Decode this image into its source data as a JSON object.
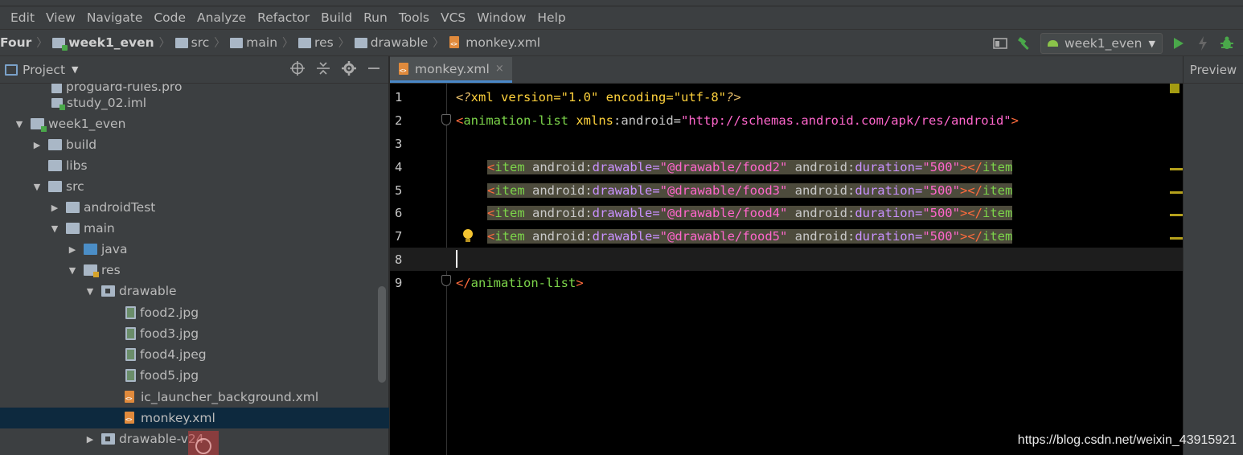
{
  "menu": [
    "Edit",
    "View",
    "Navigate",
    "Code",
    "Analyze",
    "Refactor",
    "Build",
    "Run",
    "Tools",
    "VCS",
    "Window",
    "Help"
  ],
  "breadcrumbs": {
    "project": "Four",
    "module": "week1_even",
    "src": "src",
    "main": "main",
    "res": "res",
    "drawable": "drawable",
    "file": "monkey.xml"
  },
  "run_config": {
    "label": "week1_even",
    "icons": [
      "layout-icon",
      "hammer-icon",
      "android-icon",
      "chevron-down-icon",
      "run-icon",
      "lightning-icon",
      "debug-icon"
    ]
  },
  "project_panel": {
    "title": "Project",
    "tools": [
      "target-icon",
      "collapse-icon",
      "gear-icon",
      "minimize-icon"
    ],
    "tree": [
      {
        "label": "proguard-rules.pro",
        "icon": "file-icon"
      },
      {
        "label": "study_02.iml",
        "icon": "file-icon"
      },
      {
        "label": "week1_even",
        "icon": "module-icon"
      },
      {
        "label": "build",
        "icon": "folder-icon"
      },
      {
        "label": "libs",
        "icon": "folder-icon"
      },
      {
        "label": "src",
        "icon": "folder-icon"
      },
      {
        "label": "androidTest",
        "icon": "folder-icon"
      },
      {
        "label": "main",
        "icon": "folder-icon"
      },
      {
        "label": "java",
        "icon": "source-folder-icon"
      },
      {
        "label": "res",
        "icon": "resource-folder-icon"
      },
      {
        "label": "drawable",
        "icon": "drawable-folder-icon"
      },
      {
        "label": "food2.jpg",
        "icon": "image-file-icon"
      },
      {
        "label": "food3.jpg",
        "icon": "image-file-icon"
      },
      {
        "label": "food4.jpeg",
        "icon": "image-file-icon"
      },
      {
        "label": "food5.jpg",
        "icon": "image-file-icon"
      },
      {
        "label": "ic_launcher_background.xml",
        "icon": "xml-file-icon"
      },
      {
        "label": "monkey.xml",
        "icon": "xml-file-icon",
        "selected": true
      },
      {
        "label": "drawable-v24",
        "icon": "drawable-folder-icon"
      }
    ]
  },
  "editor": {
    "tab": "monkey.xml",
    "tab_close": "×",
    "line_numbers": [
      "1",
      "2",
      "3",
      "4",
      "5",
      "6",
      "7",
      "8",
      "9"
    ],
    "lines": {
      "l1": {
        "pi_open": "<?",
        "name": "xml",
        "attr1": " version",
        "eq1": "=",
        "val1": "\"1.0\"",
        "attr2": " encoding",
        "eq2": "=",
        "val2": "\"utf-8\"",
        "pi_close": "?>"
      },
      "l2": {
        "lt": "<",
        "tag": "animation-list",
        "attr_ns": " xmlns",
        "colon": ":",
        "attr": "android",
        "eq": "=",
        "val": "\"http://schemas.android.com/apk/res/android\"",
        "gt": ">"
      },
      "items": [
        {
          "lt": "<",
          "tag": "item",
          "ns1": " android",
          "colon1": ":",
          "attr1": "drawable",
          "eq1": "=",
          "val1": "\"@drawable/food2\"",
          "ns2": " android",
          "colon2": ":",
          "attr2": "duration",
          "eq2": "=",
          "val2": "\"500\"",
          "gt": ">",
          "close_lt": "</",
          "close_tag": "item"
        },
        {
          "lt": "<",
          "tag": "item",
          "ns1": " android",
          "colon1": ":",
          "attr1": "drawable",
          "eq1": "=",
          "val1": "\"@drawable/food3\"",
          "ns2": " android",
          "colon2": ":",
          "attr2": "duration",
          "eq2": "=",
          "val2": "\"500\"",
          "gt": ">",
          "close_lt": "</",
          "close_tag": "item"
        },
        {
          "lt": "<",
          "tag": "item",
          "ns1": " android",
          "colon1": ":",
          "attr1": "drawable",
          "eq1": "=",
          "val1": "\"@drawable/food4\"",
          "ns2": " android",
          "colon2": ":",
          "attr2": "duration",
          "eq2": "=",
          "val2": "\"500\"",
          "gt": ">",
          "close_lt": "</",
          "close_tag": "item"
        },
        {
          "lt": "<",
          "tag": "item",
          "ns1": " android",
          "colon1": ":",
          "attr1": "drawable",
          "eq1": "=",
          "val1": "\"@drawable/food5\"",
          "ns2": " android",
          "colon2": ":",
          "attr2": "duration",
          "eq2": "=",
          "val2": "\"500\"",
          "gt": ">",
          "close_lt": "</",
          "close_tag": "item"
        }
      ],
      "l9": {
        "lt": "</",
        "tag": "animation-list",
        "gt": ">"
      }
    }
  },
  "preview": {
    "label": "Preview"
  },
  "watermark": "https://blog.csdn.net/weixin_43915921",
  "colors": {
    "background": "#2b2b2b",
    "editor_bg": "#000000",
    "selection": "#0d293e",
    "accent": "#4a88c7"
  }
}
